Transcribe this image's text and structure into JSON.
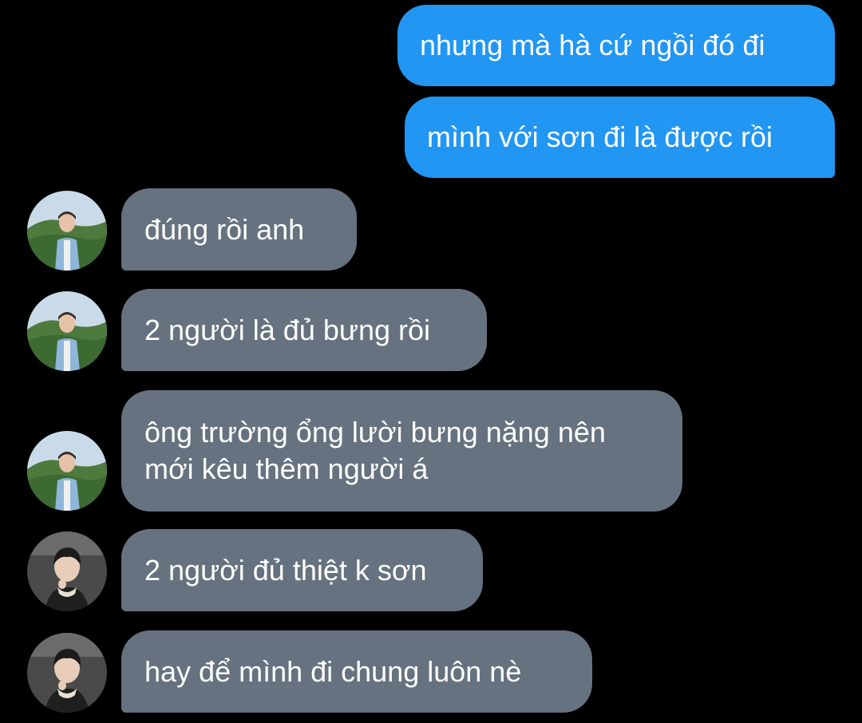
{
  "colors": {
    "background": "#000000",
    "outgoing_bubble": "#2196f3",
    "incoming_bubble": "#66727f",
    "text": "#ffffff"
  },
  "messages": [
    {
      "direction": "outgoing",
      "text": "nhưng mà hà cứ ngồi đó đi"
    },
    {
      "direction": "outgoing",
      "text": "mình với sơn đi là được rồi"
    },
    {
      "direction": "incoming",
      "avatar": "avatar-user-a",
      "text": "đúng rồi anh"
    },
    {
      "direction": "incoming",
      "avatar": "avatar-user-a",
      "text": "2 người là đủ bưng rồi"
    },
    {
      "direction": "incoming",
      "avatar": "avatar-user-a",
      "lines": [
        "ông trường ổng lười bưng nặng nên",
        "mới kêu thêm người á"
      ]
    },
    {
      "direction": "incoming",
      "avatar": "avatar-user-b",
      "text": "2 người đủ thiệt k sơn"
    },
    {
      "direction": "incoming",
      "avatar": "avatar-user-b",
      "text": "hay để mình đi chung luôn nè"
    }
  ]
}
